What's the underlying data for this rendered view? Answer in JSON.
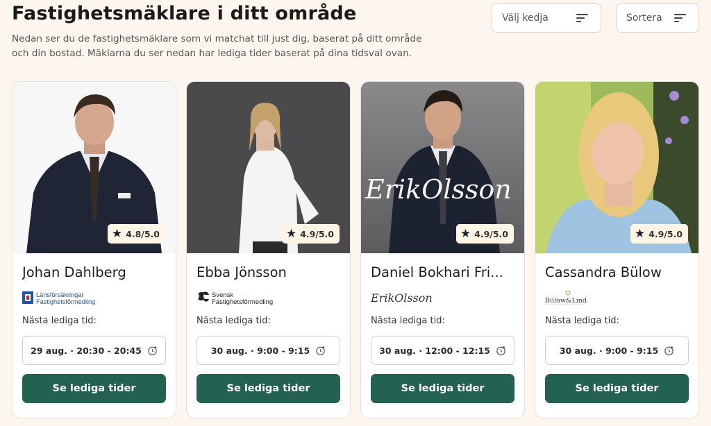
{
  "header": {
    "title": "Fastighetsmäklare i ditt område",
    "description": "Nedan ser du de fastighetsmäklare som vi matchat till just dig, baserat på ditt område och din bostad. Mäklarna du ser nedan har lediga tider baserat på dina tidsval ovan."
  },
  "filters": {
    "chain_label": "Välj kedja",
    "sort_label": "Sortera"
  },
  "agents": [
    {
      "name": "Johan Dahlberg",
      "rating": "4.8/5.0",
      "brand_line1": "Länsförsäkringar",
      "brand_line2": "Fastighetsförmedling",
      "next_label": "Nästa lediga tid:",
      "slot": "29 aug. · 20:30 - 20:45",
      "cta": "Se lediga tider"
    },
    {
      "name": "Ebba Jönsson",
      "rating": "4.9/5.0",
      "brand_line1": "Svensk",
      "brand_line2": "Fastighetsförmedling",
      "next_label": "Nästa lediga tid:",
      "slot": "30 aug. · 9:00 - 9:15",
      "cta": "Se lediga tider"
    },
    {
      "name": "Daniel Bokhari Fri...",
      "rating": "4.9/5.0",
      "brand_line1": "ErikOlsson",
      "brand_photo_overlay": "ErikOlsson",
      "next_label": "Nästa lediga tid:",
      "slot": "30 aug. · 12:00 - 12:15",
      "cta": "Se lediga tider"
    },
    {
      "name": "Cassandra Bülow",
      "rating": "4.9/5.0",
      "brand_line1": "Bülow&Lind",
      "next_label": "Nästa lediga tid:",
      "slot": "30 aug. · 9:00 - 9:15",
      "cta": "Se lediga tider"
    }
  ],
  "colors": {
    "background": "#fdf6ee",
    "primary_button": "#236251",
    "rating_badge": "#fff5e4",
    "star": "#1c2433"
  },
  "icons": {
    "filter": "filter-lines-icon",
    "star": "star-icon",
    "clock": "clock-plus-icon"
  }
}
